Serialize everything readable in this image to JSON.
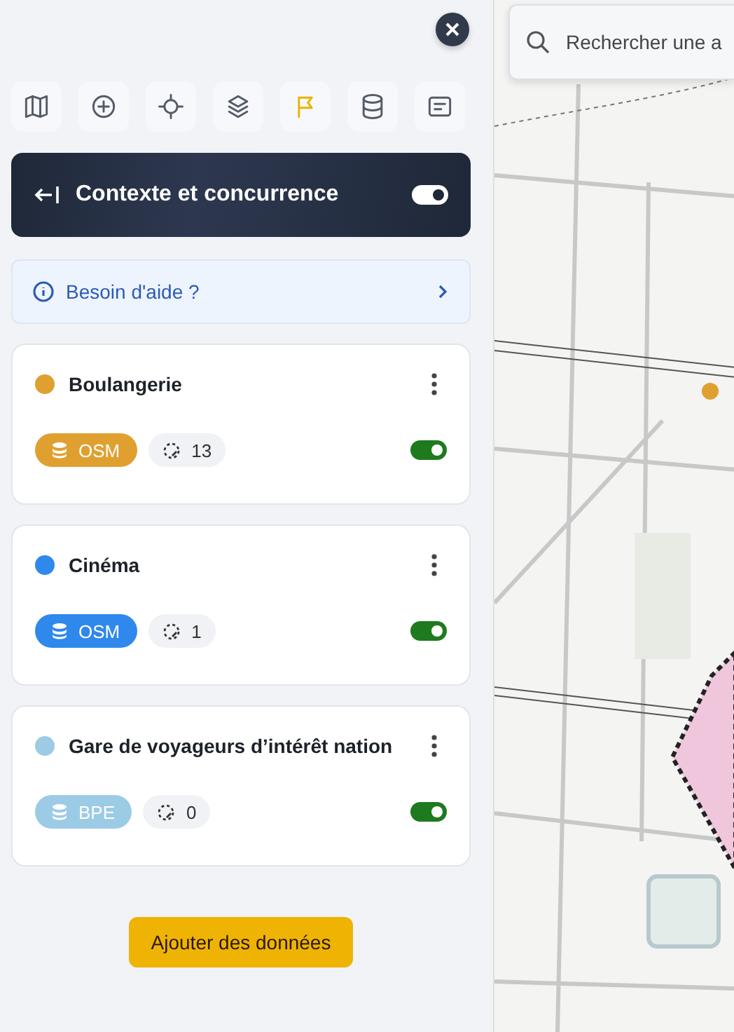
{
  "toolbar": [
    {
      "kind": "map",
      "selected": false
    },
    {
      "kind": "plus",
      "selected": false
    },
    {
      "kind": "target",
      "selected": false
    },
    {
      "kind": "layers",
      "selected": false
    },
    {
      "kind": "flag",
      "selected": true
    },
    {
      "kind": "database",
      "selected": false
    },
    {
      "kind": "note",
      "selected": false
    }
  ],
  "header": {
    "title": "Contexte et concurrence",
    "on": true
  },
  "help": {
    "label": "Besoin d'aide ?"
  },
  "layers": [
    {
      "name": "Boulangerie",
      "color": "#e0a030",
      "source": "OSM",
      "count": "13",
      "on": true
    },
    {
      "name": "Cinéma",
      "color": "#2f88ec",
      "source": "OSM",
      "count": "1",
      "on": true
    },
    {
      "name": "Gare de voyageurs d’intérêt nation",
      "color": "#9ccbe6",
      "source": "BPE",
      "count": "0",
      "on": true
    }
  ],
  "add_button": "Ajouter des données",
  "search": {
    "placeholder": "Rechercher une a"
  }
}
